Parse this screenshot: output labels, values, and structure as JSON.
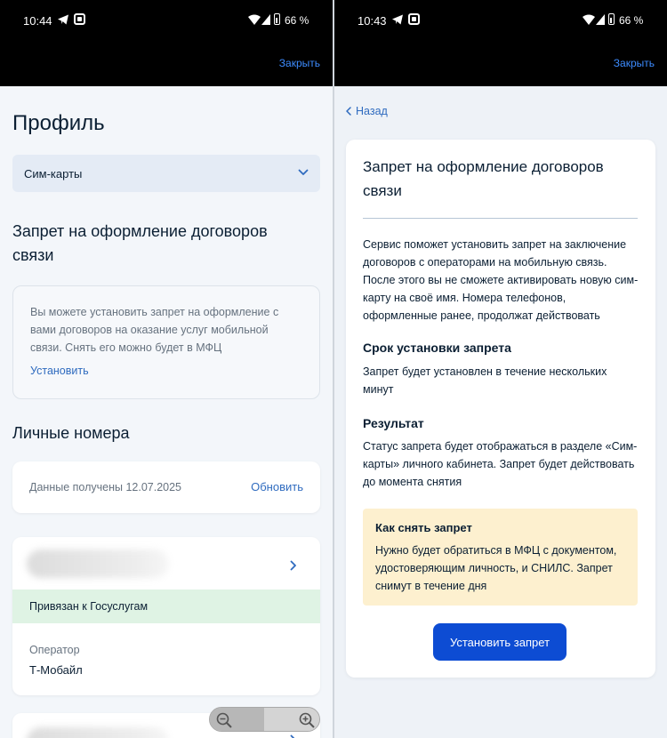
{
  "status_left": {
    "time": "10:44",
    "battery": "66 %"
  },
  "status_right": {
    "time": "10:43",
    "battery": "66 %"
  },
  "header": {
    "close_label": "Закрыть"
  },
  "profile": {
    "title": "Профиль",
    "select_value": "Сим-карты",
    "ban_title": "Запрет на оформление договоров связи",
    "ban_info": "Вы можете установить запрет на оформление с вами договоров на оказание услуг мобильной связи. Снять его можно будет в МФЦ",
    "ban_link": "Установить",
    "personal_title": "Личные номера",
    "data_received": "Данные получены 12.07.2025",
    "refresh_label": "Обновить",
    "linked_label": "Привязан к Госуслугам",
    "operator_label": "Оператор",
    "operator_value": "Т-Мобайл"
  },
  "detail": {
    "back_label": "Назад",
    "title": "Запрет на оформление договоров связи",
    "description": "Сервис поможет установить запрет на заключение договоров с операторами на мобильную связь. После этого вы не сможете активировать новую сим-карту на своё имя. Номера телефонов, оформленные ранее, продолжат действовать",
    "term_title": "Срок установки запрета",
    "term_text": "Запрет будет установлен в течение нескольких минут",
    "result_title": "Результат",
    "result_text": "Статус запрета будет отображаться в разделе «Сим-карты» личного кабинета. Запрет будет действовать до момента снятия",
    "note_title": "Как снять запрет",
    "note_text": "Нужно будет обратиться в МФЦ с документом, удостоверяющим личность, и СНИЛС. Запрет снимут в течение дня",
    "cta_label": "Установить запрет"
  },
  "colors": {
    "link": "#2f6bbf",
    "primary": "#0d4cd3",
    "linked_bg": "#dff3e4",
    "note_bg": "#fdf0cf"
  },
  "icons": [
    "telegram-icon",
    "app-icon",
    "wifi-icon",
    "signal-icon",
    "battery-icon",
    "chevron-down-icon",
    "chevron-right-icon",
    "chevron-left-icon",
    "zoom-out-icon",
    "zoom-in-icon"
  ]
}
